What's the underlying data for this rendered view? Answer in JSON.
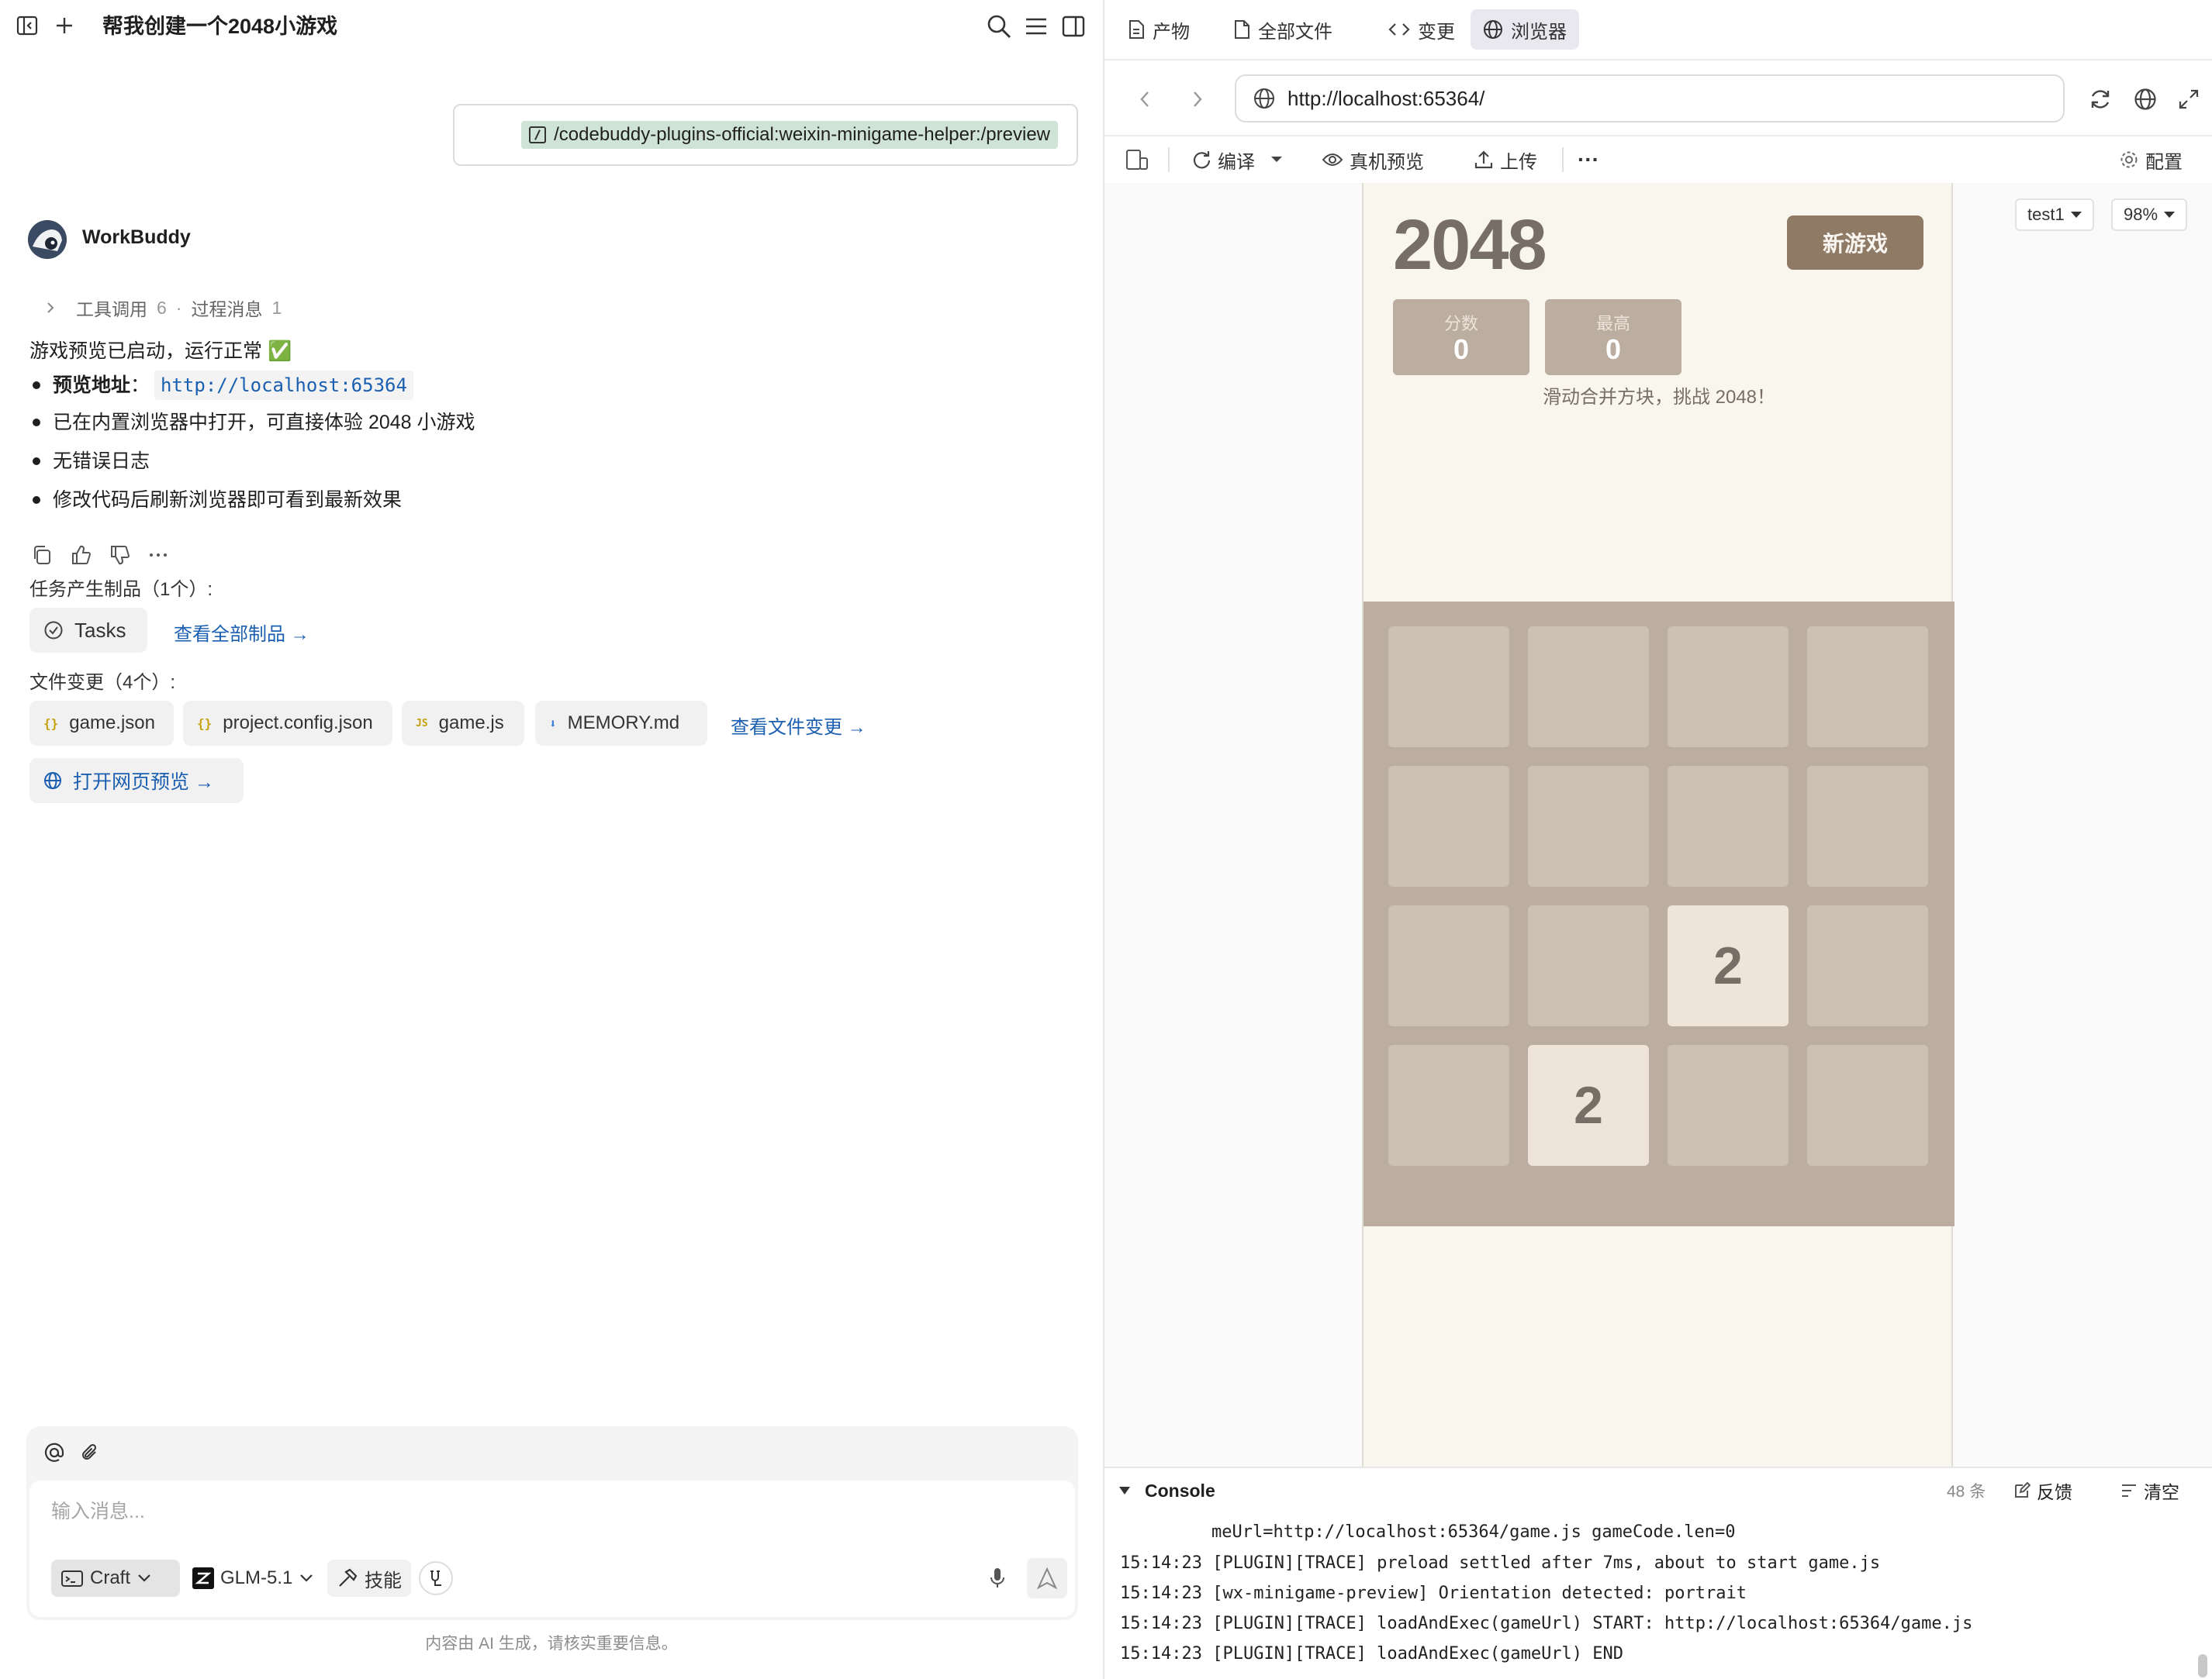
{
  "left": {
    "title": "帮我创建一个2048小游戏",
    "user_command": "/codebuddy-plugins-official:weixin-minigame-helper:/preview",
    "bot_name": "WorkBuddy",
    "meta": {
      "tools_label": "工具调用",
      "tools_count": "6",
      "sep": "·",
      "process_label": "过程消息",
      "process_count": "1"
    },
    "status_text": "游戏预览已启动，运行正常 ✅",
    "bullets": [
      {
        "label": "预览地址",
        "colon": "：",
        "link": "http://localhost:65364"
      },
      {
        "text": "已在内置浏览器中打开，可直接体验 2048 小游戏"
      },
      {
        "text": "无错误日志"
      },
      {
        "text": "修改代码后刷新浏览器即可看到最新效果"
      }
    ],
    "artifacts_label": "任务产生制品（1个）:",
    "artifact_chip": "Tasks",
    "view_all_artifacts": "查看全部制品 →",
    "files_label": "文件变更（4个）:",
    "files": [
      {
        "icon": "{}",
        "name": "game.json",
        "color": "#c6a00e"
      },
      {
        "icon": "{}",
        "name": "project.config.json",
        "color": "#c6a00e"
      },
      {
        "icon": "JS",
        "name": "game.js",
        "color": "#c6a00e"
      },
      {
        "icon": "⬇",
        "name": "MEMORY.md",
        "color": "#3b7dd8"
      }
    ],
    "view_file_changes": "查看文件变更 →",
    "open_preview": "打开网页预览 →",
    "input": {
      "placeholder": "输入消息...",
      "mode": "Craft",
      "model": "GLM-5.1",
      "skills": "技能"
    },
    "footer": "内容由 AI 生成，请核实重要信息。"
  },
  "right": {
    "tabs": [
      {
        "icon": "doc",
        "label": "产物"
      },
      {
        "icon": "file",
        "label": "全部文件"
      },
      {
        "icon": "code",
        "label": "变更"
      },
      {
        "icon": "globe",
        "label": "浏览器"
      }
    ],
    "url": "http://localhost:65364/",
    "toolbar": {
      "compile": "编译",
      "device_preview": "真机预览",
      "upload": "上传",
      "more": "···",
      "config": "配置"
    },
    "device_select": "test1",
    "zoom": "98%",
    "game": {
      "title": "2048",
      "new_game": "新游戏",
      "score_label": "分数",
      "score": "0",
      "best_label": "最高",
      "best": "0",
      "subtitle": "滑动合并方块，挑战 2048！",
      "grid": [
        [
          0,
          0,
          0,
          0
        ],
        [
          0,
          0,
          0,
          0
        ],
        [
          0,
          0,
          2,
          0
        ],
        [
          0,
          2,
          0,
          0
        ]
      ]
    },
    "console": {
      "title": "Console",
      "count": "48 条",
      "feedback": "反馈",
      "clear": "清空",
      "lines": [
        {
          "time": "",
          "text": "meUrl=http://localhost:65364/game.js gameCode.len=0"
        },
        {
          "time": "15:14:23",
          "text": "[PLUGIN][TRACE] preload settled after 7ms, about to start game.js"
        },
        {
          "time": "15:14:23",
          "text": "[wx-minigame-preview] Orientation detected: portrait"
        },
        {
          "time": "15:14:23",
          "text": "[PLUGIN][TRACE] loadAndExec(gameUrl) START: http://localhost:65364/game.js"
        },
        {
          "time": "15:14:23",
          "text": "[PLUGIN][TRACE] loadAndExec(gameUrl) END"
        }
      ]
    }
  }
}
